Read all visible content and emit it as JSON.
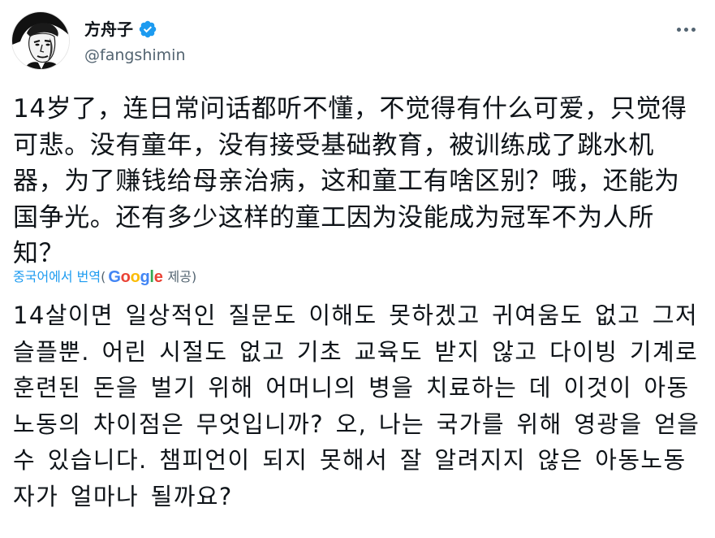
{
  "author": {
    "display_name": "方舟子",
    "handle": "@fangshimin",
    "verified": true,
    "avatar_icon": "portrait-avatar"
  },
  "menu": {
    "more_icon": "more-horizontal-icon"
  },
  "tweet": {
    "text": "14岁了，连日常问话都听不懂，不觉得有什么可爱，只觉得可悲。没有童年，没有接受基础教育，被训练成了跳水机器，为了赚钱给母亲治病，这和童工有啥区别？哦，还能为国争光。还有多少这样的童工因为没能成为冠军不为人所知？"
  },
  "translation": {
    "link_label": "중국어에서 번역",
    "open_paren": "(",
    "provider_letters": [
      "G",
      "o",
      "o",
      "g",
      "l",
      "e"
    ],
    "provided_by": "제공)",
    "text": "14살이면 일상적인 질문도 이해도 못하겠고 귀여움도 없고 그저 슬플뿐. 어린 시절도 없고 기초 교육도 받지 않고 다이빙 기계로 훈련된 돈을 벌기 위해 어머니의 병을 치료하는 데 이것이 아동 노동의 차이점은 무엇입니까? 오, 나는 국가를 위해 영광을 얻을 수 있습니다. 챔피언이 되지 못해서 잘 알려지지 않은 아동노동자가 얼마나 될까요?"
  },
  "colors": {
    "link": "#1d9bf0",
    "text": "#0f1419",
    "secondary": "#536471",
    "verified": "#1d9bf0"
  }
}
